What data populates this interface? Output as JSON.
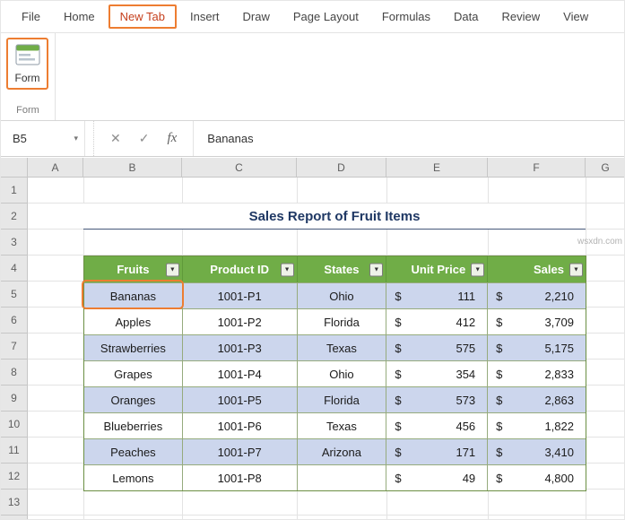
{
  "ribbon": {
    "tabs": [
      "File",
      "Home",
      "New Tab",
      "Insert",
      "Draw",
      "Page Layout",
      "Formulas",
      "Data",
      "Review",
      "View"
    ],
    "highlighted_tab": "New Tab",
    "form_button_label": "Form",
    "form_group_label": "Form"
  },
  "formula_bar": {
    "name_box": "B5",
    "value": "Bananas"
  },
  "icons": {
    "name_box_arrow": "▾",
    "cancel": "✕",
    "enter": "✓",
    "fx": "fx",
    "filter": "▼"
  },
  "grid": {
    "column_headers": [
      "A",
      "B",
      "C",
      "D",
      "E",
      "F",
      "G"
    ],
    "row_headers": [
      "1",
      "2",
      "3",
      "4",
      "5",
      "6",
      "7",
      "8",
      "9",
      "10",
      "11",
      "12",
      "13"
    ]
  },
  "sheet": {
    "title": "Sales Report of Fruit Items",
    "table": {
      "currency": "$",
      "headers": [
        "Fruits",
        "Product ID",
        "States",
        "Unit Price",
        "Sales"
      ],
      "rows": [
        {
          "fruit": "Bananas",
          "id": "1001-P1",
          "state": "Ohio",
          "price": "111",
          "sales": "2,210"
        },
        {
          "fruit": "Apples",
          "id": "1001-P2",
          "state": "Florida",
          "price": "412",
          "sales": "3,709"
        },
        {
          "fruit": "Strawberries",
          "id": "1001-P3",
          "state": "Texas",
          "price": "575",
          "sales": "5,175"
        },
        {
          "fruit": "Grapes",
          "id": "1001-P4",
          "state": "Ohio",
          "price": "354",
          "sales": "2,833"
        },
        {
          "fruit": "Oranges",
          "id": "1001-P5",
          "state": "Florida",
          "price": "573",
          "sales": "2,863"
        },
        {
          "fruit": "Blueberries",
          "id": "1001-P6",
          "state": "Texas",
          "price": "456",
          "sales": "1,822"
        },
        {
          "fruit": "Peaches",
          "id": "1001-P7",
          "state": "Arizona",
          "price": "171",
          "sales": "3,410"
        },
        {
          "fruit": "Lemons",
          "id": "1001-P8",
          "state": "",
          "price": "49",
          "sales": "4,800"
        }
      ]
    }
  },
  "watermark": "wsxdn.com",
  "colors": {
    "accent_orange": "#ed7d31",
    "header_green": "#70ad47",
    "band_blue": "#ccd6ed",
    "title_navy": "#1f3864",
    "highlight_tab_red": "#c6401d"
  }
}
